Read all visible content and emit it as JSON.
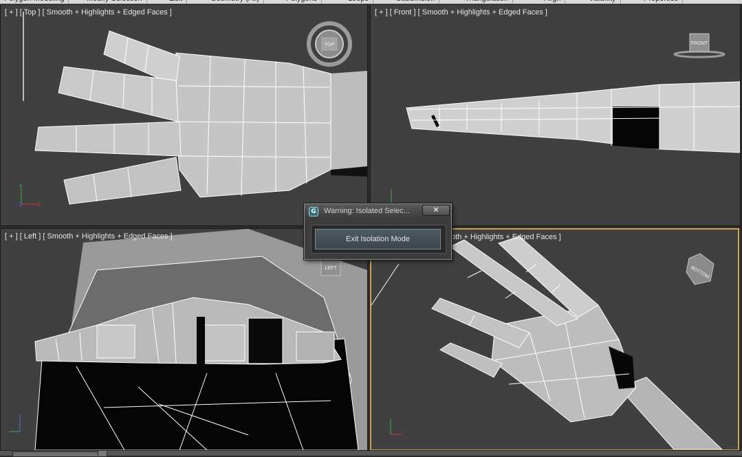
{
  "ribbon": {
    "tabs": [
      "Polygon Modeling",
      "Modify Selection",
      "Edit",
      "Geometry (All)",
      "Polygons",
      "Loops",
      "Subdivision",
      "Triangulation",
      "Align",
      "Visibility",
      "Properties"
    ]
  },
  "viewports": {
    "top": {
      "label": "[ + ] [ Top ] [ Smooth + Highlights + Edged Faces ]",
      "gizmo": "TOP"
    },
    "front": {
      "label": "[ + ] [ Front ] [ Smooth + Highlights + Edged Faces ]",
      "gizmo": "FRONT"
    },
    "left": {
      "label": "[ + ] [ Left ] [ Smooth + Highlights + Edged Faces ]",
      "gizmo": "LEFT"
    },
    "perspective": {
      "label": "ooth + Highlights + Edged Faces ]",
      "gizmo": "BOTTOM"
    }
  },
  "axes": {
    "x": "x",
    "y": "y",
    "z": "z"
  },
  "dialog": {
    "title": "Warning: Isolated Selec...",
    "close_glyph": "✕",
    "app_icon_glyph": "G",
    "button_label": "Exit Isolation Mode"
  },
  "colors": {
    "viewport_bg": "#404040",
    "active_border": "#c9a74a",
    "wire": "#ffffff",
    "axis_x": "#d23a3a",
    "axis_y": "#39b54a",
    "axis_z": "#4a6cd4"
  }
}
